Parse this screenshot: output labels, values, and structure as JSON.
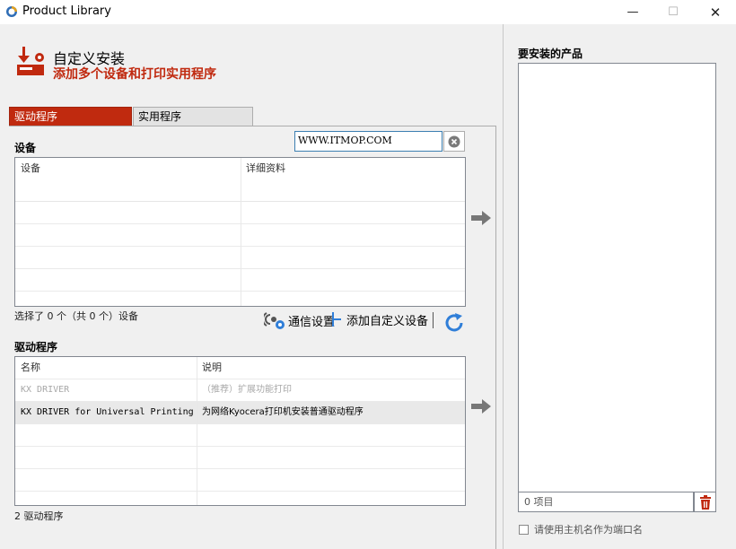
{
  "window": {
    "title": "Product Library",
    "min_glyph": "—",
    "max_glyph": "☐",
    "close_glyph": "✕"
  },
  "header": {
    "title": "自定义安装",
    "subtitle": "添加多个设备和打印实用程序",
    "accent_color": "#c0290f"
  },
  "tabs": [
    {
      "label": "驱动程序",
      "active": true
    },
    {
      "label": "实用程序",
      "active": false
    }
  ],
  "devices": {
    "section_label": "设备",
    "search_value": "WWW.ITMOP.COM",
    "columns": [
      "设备",
      "详细资料"
    ],
    "rows": [],
    "status": "选择了 0 个（共 0 个）设备",
    "comm_settings_label": "通信设置",
    "add_custom_device_label": "添加自定义设备"
  },
  "drivers": {
    "section_label": "驱动程序",
    "columns": [
      "名称",
      "说明"
    ],
    "rows": [
      {
        "name": "KX DRIVER",
        "description": "（推荐）扩展功能打印",
        "dimmed": true
      },
      {
        "name": "KX DRIVER for Universal Printing",
        "description": "为网络Kyocera打印机安装普通驱动程序",
        "dimmed": false
      }
    ],
    "status": "2 驱动程序"
  },
  "install_pane": {
    "title": "要安装的产品",
    "count_label": "0 项目",
    "checkbox_label": "请使用主机名作为端口名"
  },
  "icons": {
    "app": "product-library-icon",
    "header": "install-printer-icon",
    "search_clear": "clear-icon",
    "add_arrow": "right-arrow-icon",
    "comm": "communication-settings-icon",
    "add_device": "add-device-icon",
    "refresh": "refresh-icon",
    "trash": "trash-icon"
  }
}
